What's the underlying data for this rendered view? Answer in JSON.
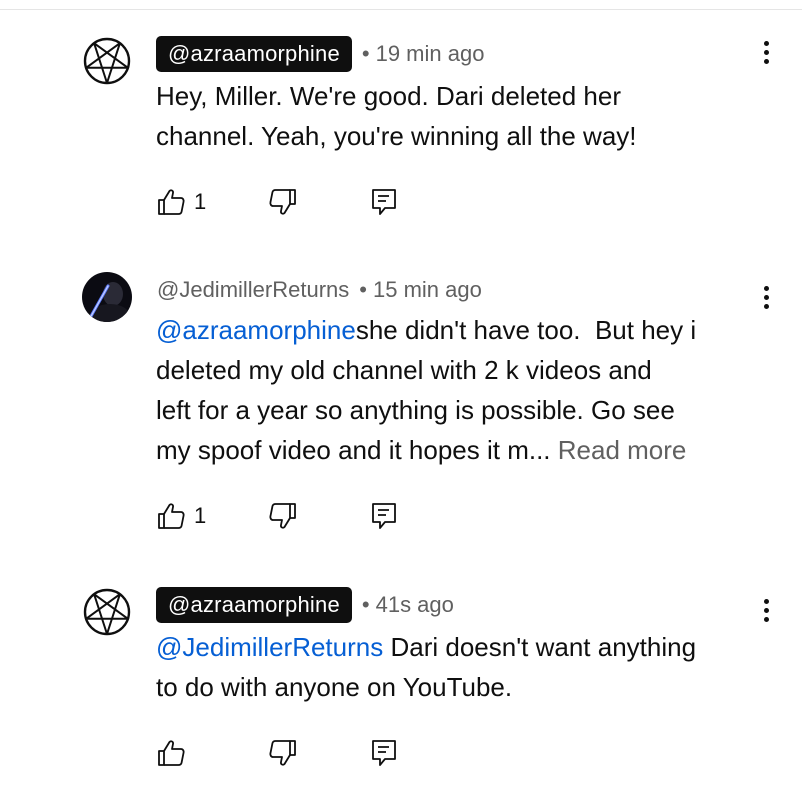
{
  "comments": [
    {
      "handle": "@azraamorphine",
      "handle_style": "badge",
      "avatar": "pentagram-icon",
      "separator": "•",
      "time": "19 min ago",
      "mention": "",
      "text": "Hey, Miller. We're good. Dari deleted her\nchannel. Yeah, you're winning all the way!",
      "read_more": "",
      "likes": "1"
    },
    {
      "handle": "@JedimillerReturns",
      "handle_style": "plain",
      "avatar": "lightsaber-photo",
      "separator": "•",
      "time": "15 min ago",
      "mention": "@azraamorphine",
      "text": "she didn't have too.  But hey i\ndeleted my old channel with 2 k videos and\nleft for a year so anything is possible. Go see\nmy spoof video and it hopes it m... ",
      "read_more": "Read more",
      "likes": "1"
    },
    {
      "handle": "@azraamorphine",
      "handle_style": "badge",
      "avatar": "pentagram-icon",
      "separator": "•",
      "time": "41s ago",
      "mention": "@JedimillerReturns",
      "text": " Dari doesn't want anything\nto do with anyone on YouTube.",
      "read_more": "",
      "likes": ""
    }
  ],
  "colors": {
    "text": "#0f0f0f",
    "secondary": "#606060",
    "mention": "#065fd4",
    "badge_bg": "#0f0f0f"
  },
  "icons": {
    "like": "thumbs-up-icon",
    "dislike": "thumbs-down-icon",
    "reply": "reply-comment-icon",
    "more": "more-vertical-icon"
  }
}
